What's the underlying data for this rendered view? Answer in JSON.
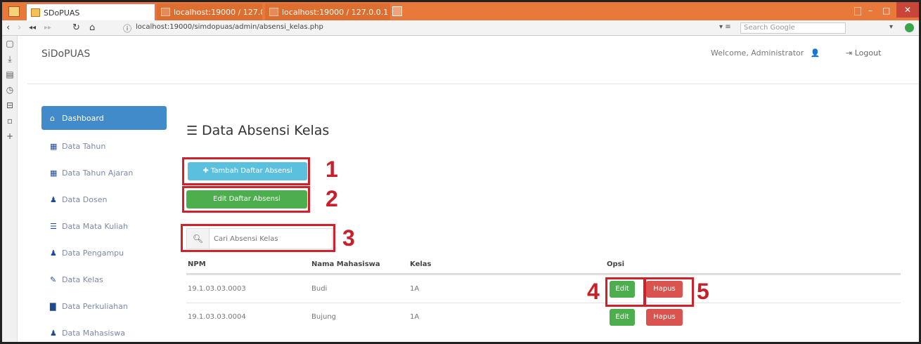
{
  "browser": {
    "tabs": [
      {
        "label": "SDoPUAS"
      },
      {
        "label": "localhost:19000 / 127.0.0.1"
      },
      {
        "label": "localhost:19000 / 127.0.0.1"
      }
    ],
    "url": "localhost:19000/simdopuas/admin/absensi_kelas.php",
    "search_placeholder": "Search Google"
  },
  "header": {
    "brand": "SiDoPUAS",
    "welcome": "Welcome, Administrator",
    "logout": "Logout"
  },
  "sidebar": {
    "items": [
      {
        "label": "Dashboard"
      },
      {
        "label": "Data Tahun"
      },
      {
        "label": "Data Tahun Ajaran"
      },
      {
        "label": "Data Dosen"
      },
      {
        "label": "Data Mata Kuliah"
      },
      {
        "label": "Data Pengampu"
      },
      {
        "label": "Data Kelas"
      },
      {
        "label": "Data Perkuliahan"
      },
      {
        "label": "Data Mahasiswa"
      }
    ]
  },
  "main": {
    "title": "Data Absensi Kelas",
    "add_button": "Tambah Daftar Absensi",
    "edit_list_button": "Edit Daftar Absensi",
    "search_placeholder": "Cari Absensi Kelas",
    "table": {
      "headers": [
        "NPM",
        "Nama Mahasiswa",
        "Kelas",
        "Opsi"
      ],
      "rows": [
        {
          "npm": "19.1.03.03.0003",
          "nama": "Budi",
          "kelas": "1A",
          "edit": "Edit",
          "hapus": "Hapus"
        },
        {
          "npm": "19.1.03.03.0004",
          "nama": "Bujung",
          "kelas": "1A",
          "edit": "Edit",
          "hapus": "Hapus"
        }
      ]
    }
  },
  "annotations": [
    "1",
    "2",
    "3",
    "4",
    "5"
  ],
  "colors": {
    "titlebar": "#e8793a",
    "primary": "#428bca",
    "info": "#5bc0de",
    "success": "#4cae4c",
    "danger": "#d9534f",
    "annotation": "#c8202a"
  }
}
